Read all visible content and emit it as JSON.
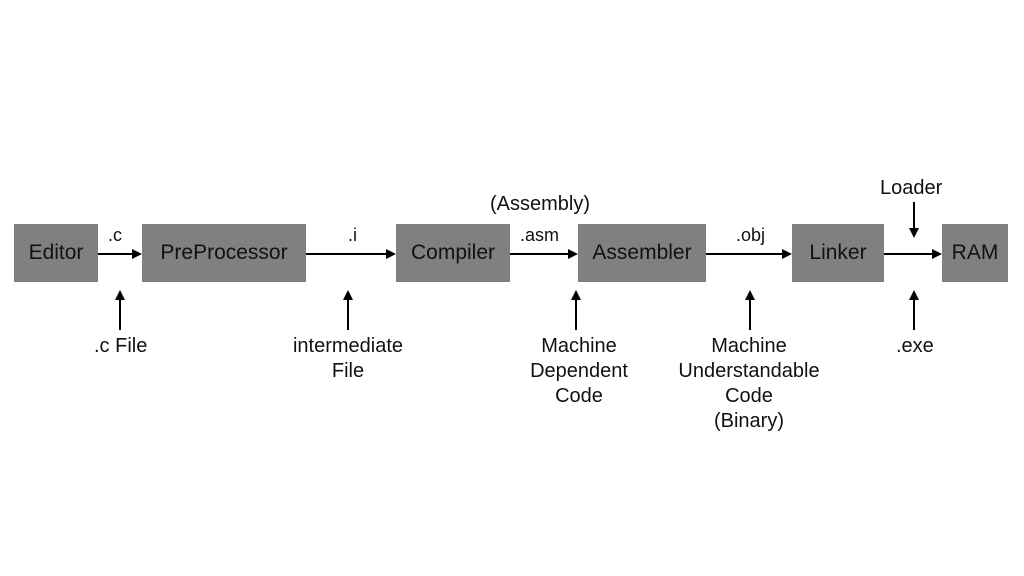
{
  "nodes": {
    "editor": "Editor",
    "preprocessor": "PreProcessor",
    "compiler": "Compiler",
    "assembler": "Assembler",
    "linker": "Linker",
    "ram": "RAM"
  },
  "edge_labels": {
    "editor_to_pre": ".c",
    "pre_to_compiler": ".i",
    "compiler_to_asm": ".asm",
    "asm_to_linker": ".obj",
    "assembly_note": "(Assembly)"
  },
  "annotations": {
    "c_file": ".c File",
    "intermediate": "intermediate\nFile",
    "machine_dep": "Machine\nDependent\nCode",
    "machine_und": "Machine\nUnderstandable\nCode\n(Binary)",
    "loader": "Loader",
    "exe": ".exe"
  }
}
